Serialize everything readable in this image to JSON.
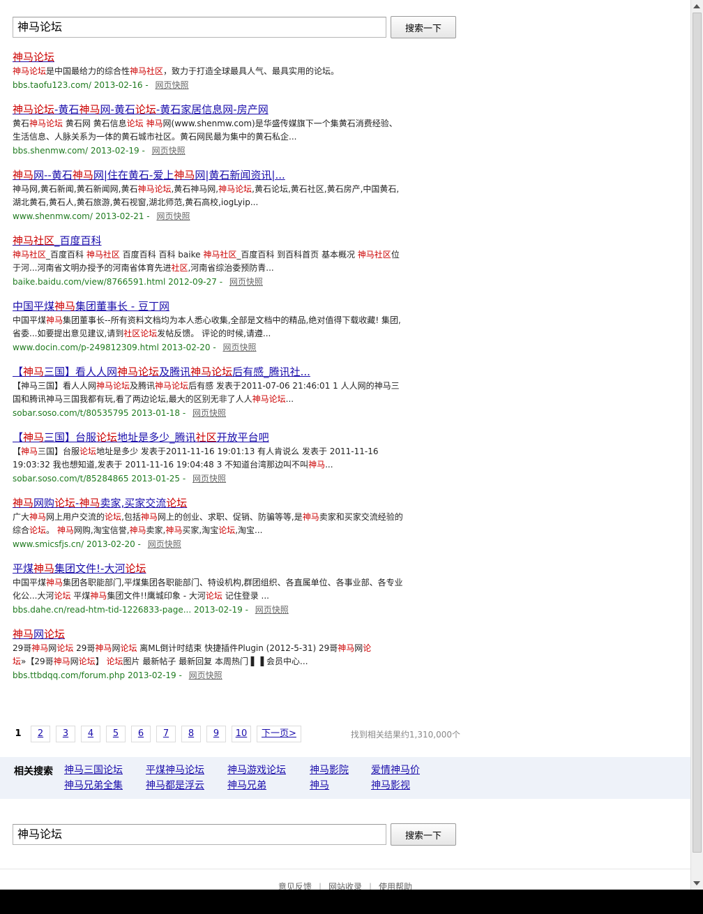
{
  "search": {
    "query": "神马论坛",
    "button_label": "搜索一下"
  },
  "results": [
    {
      "title": "<em>神马论坛</em>",
      "snippet": "<em>神马论坛</em>是中国最给力的综合性<em>神马社区</em>，致力于打造全球最具人气、最具实用的论坛。",
      "url": "bbs.taofu123.com/",
      "date": "2013-02-16",
      "snapshot": "网页快照"
    },
    {
      "title": "<em>神马论坛</em>-黄石<em>神马</em>网-黄石<em>论坛</em>-黄石家居信息网-房产网",
      "snippet": "黄石<em>神马论坛</em> 黄石网 黄石信息<em>论坛</em> <em>神马</em>网(www.shenmw.com)是华盛传媒旗下一个集黄石消费经验、生活信息、人脉关系为一体的黄石城市社区。黄石网民最为集中的黄石私企...",
      "url": "bbs.shenmw.com/",
      "date": "2013-02-19",
      "snapshot": "网页快照"
    },
    {
      "title": "<em>神马</em>网--黄石<em>神马</em>网|住在黄石-爱上<em>神马</em>网|黄石新闻资讯|...",
      "snippet": "神马网,黄石新闻,黄石新闻网,黄石<em>神马论坛</em>,黄石神马网,<em>神马论坛</em>,黄石论坛,黄石社区,黄石房产,中国黄石,湖北黄石,黄石人,黄石旅游,黄石视窗,湖北师范,黄石高校,iogLyip...",
      "url": "www.shenmw.com/",
      "date": "2013-02-21",
      "snapshot": "网页快照"
    },
    {
      "title": "<em>神马社区</em>_百度百科",
      "snippet": "<em>神马社区</em>_百度百科 <em>神马社区</em> 百度百科 百科 baike <em>神马社区</em>_百度百科 到百科首页 基本概况 <em>神马社区</em>位于河...河南省文明办授予的河南省体育先进<em>社区</em>,河南省综治委预防青...",
      "url": "baike.baidu.com/view/8766591.html",
      "date": "2012-09-27",
      "snapshot": "网页快照"
    },
    {
      "title": "中国平煤<em>神马</em>集团董事长 - 豆丁网",
      "snippet": "中国平煤<em>神马</em>集团董事长--所有资料文档均为本人悉心收集,全部是文档中的精品,绝对值得下载收藏! 集团,省委...如要提出意见建议,请到<em>社区论坛</em>发帖反馈。 评论的时候,请遵...",
      "url": "www.docin.com/p-249812309.html",
      "date": "2013-02-20",
      "snapshot": "网页快照"
    },
    {
      "title": "【<em>神马</em>三国】看人人网<em>神马论坛</em>及腾讯<em>神马论坛</em>后有感_腾讯社...",
      "snippet": "【神马三国】看人人网<em>神马论坛</em>及腾讯<em>神马论坛</em>后有感 发表于2011-07-06 21:46:01 1 人人网的神马三国和腾讯神马三国我都有玩,看了两边论坛,最大的区别无非了人人<em>神马论坛</em>...",
      "url": "sobar.soso.com/t/80535795",
      "date": "2013-01-18",
      "snapshot": "网页快照"
    },
    {
      "title": "【<em>神马</em>三国】台服<em>论坛</em>地址是多少_腾讯<em>社区</em>开放平台吧",
      "snippet": "【<em>神马</em>三国】台服<em>论坛</em>地址是多少 发表于2011-11-16 19:01:13 有人肯说么 发表于 2011-11-16 19:03:32 我也想知道,发表于 2011-11-16 19:04:48 3 不知道台湾那边叫不叫<em>神马</em>...",
      "url": "sobar.soso.com/t/85284865",
      "date": "2013-01-25",
      "snapshot": "网页快照"
    },
    {
      "title": "<em>神马</em>网购<em>论坛</em>-<em>神马</em>卖家,买家交流<em>论坛</em>",
      "snippet": "广大<em>神马</em>网上用户交流的<em>论坛</em>,包括<em>神马</em>网上的创业、求职、促销、防骗等等,是<em>神马</em>卖家和买家交流经验的综合<em>论坛</em>。 <em>神马</em>网购,淘宝信誉,<em>神马</em>卖家,<em>神马</em>买家,淘宝<em>论坛</em>,淘宝...",
      "url": "www.smicsfjs.cn/",
      "date": "2013-02-20",
      "snapshot": "网页快照"
    },
    {
      "title": "平煤<em>神马</em>集团文件!-大河<em>论坛</em>",
      "snippet": "中国平煤<em>神马</em>集团各职能部门,平煤集团各职能部门、特设机构,群团组织、各直属单位、各事业部、各专业化公...大河<em>论坛</em> 平煤<em>神马</em>集团文件!!鹰城印象 - 大河<em>论坛</em> 记住登录 ...",
      "url": "bbs.dahe.cn/read-htm-tid-1226833-page...",
      "date": "2013-02-19",
      "snapshot": "网页快照"
    },
    {
      "title": "<em>神马</em>网<em>论坛</em>",
      "snippet": "29哥<em>神马</em>网<em>论坛</em> 29哥<em>神马</em>网<em>论坛</em> 离ML倒计时结束 快捷插件Plugin (2012-5-31) 29哥<em>神马</em>网<em>论坛</em>»【29哥<em>神马</em>网<em>论坛</em>】 <em>论坛</em>图片 最新帖子 最新回复 本周热门 ▌▐ 会员中心...",
      "url": "bbs.ttbdqq.com/forum.php",
      "date": "2013-02-19",
      "snapshot": "网页快照"
    }
  ],
  "pager": {
    "current": "1",
    "pages": [
      "2",
      "3",
      "4",
      "5",
      "6",
      "7",
      "8",
      "9",
      "10"
    ],
    "next": "下一页>",
    "total": "找到相关结果约1,310,000个"
  },
  "related": {
    "label": "相关搜索",
    "items": [
      "神马三国论坛",
      "平煤神马论坛",
      "神马游戏论坛",
      "神马影院",
      "爱情神马价",
      "神马兄弟全集",
      "神马都是浮云",
      "神马兄弟",
      "神马",
      "神马影视"
    ]
  },
  "footer": {
    "links": [
      "意见反馈",
      "网站收录",
      "使用帮助"
    ]
  }
}
